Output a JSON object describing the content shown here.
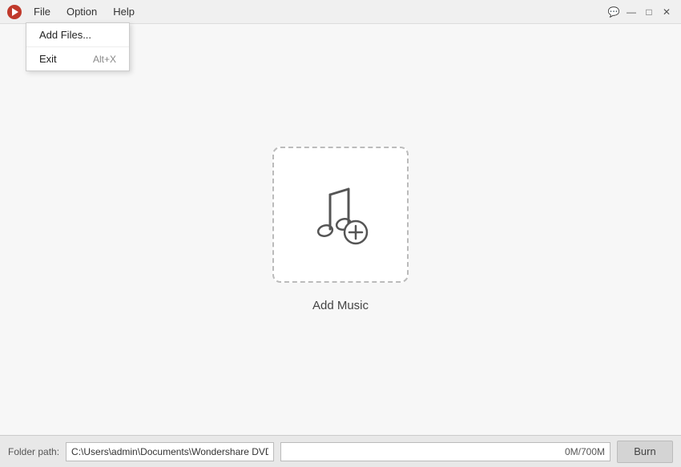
{
  "titleBar": {
    "menuItems": [
      {
        "id": "file",
        "label": "File",
        "active": true
      },
      {
        "id": "option",
        "label": "Option",
        "active": false
      },
      {
        "id": "help",
        "label": "Help",
        "active": false
      }
    ],
    "controls": {
      "chat": "💬",
      "minimize": "—",
      "maximize": "□",
      "close": "✕"
    }
  },
  "fileMenu": {
    "items": [
      {
        "id": "add-files",
        "label": "Add Files...",
        "shortcut": ""
      },
      {
        "id": "exit",
        "label": "Exit",
        "shortcut": "Alt+X"
      }
    ]
  },
  "mainArea": {
    "addMusicLabel": "Add Music"
  },
  "bottomBar": {
    "folderLabel": "Folder path:",
    "folderPath": "C:\\Users\\admin\\Documents\\Wondershare DVD Creat...",
    "sizeDisplay": "0M/700M",
    "burnLabel": "Burn"
  }
}
